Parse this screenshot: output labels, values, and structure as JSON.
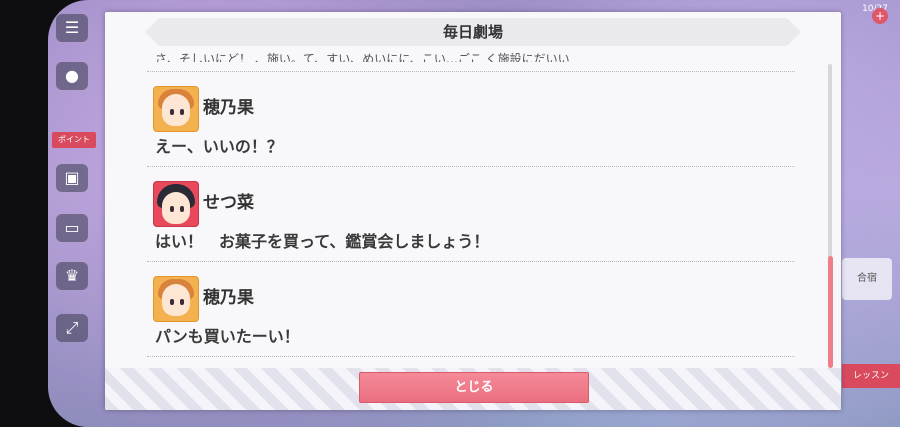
{
  "dialog": {
    "title": "毎日劇場",
    "cut_off_line": "さ、そしいにど！ 、施い。て、すい、めいにに、こい…ごこ く施設にだいい",
    "messages": [
      {
        "speaker": "穂乃果",
        "text": "えー、いいの！？",
        "avatar": "orange"
      },
      {
        "speaker": "せつ菜",
        "text": "はい！　お菓子を買って、鑑賞会しましょう！",
        "avatar": "red"
      },
      {
        "speaker": "穂乃果",
        "text": "パンも買いたーい！",
        "avatar": "orange"
      }
    ],
    "close_label": "とじる",
    "scroll_position": 0.85
  },
  "background": {
    "rail_badge": "ポイント",
    "hud_text": "10/27",
    "side_card": "合宿",
    "side_red": "レッスン"
  },
  "colors": {
    "accent": "#ea6f80",
    "dialog_bg": "#f8f8fb",
    "title_bg": "#e9e9ee"
  }
}
